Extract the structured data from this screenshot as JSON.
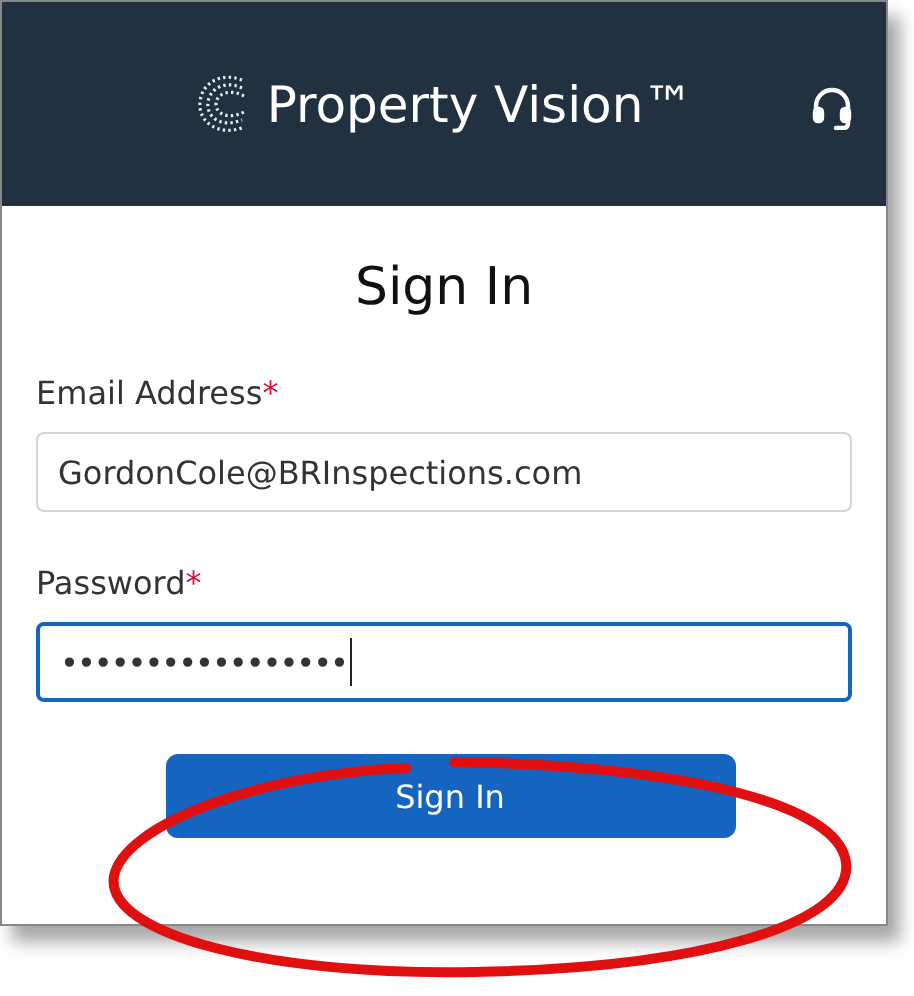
{
  "header": {
    "title": "Property Vision™"
  },
  "form": {
    "title": "Sign In",
    "fields": [
      {
        "label": "Email Address",
        "required_mark": "*",
        "value": "GordonCole@BRInspections.com",
        "focused": false
      },
      {
        "label": "Password",
        "required_mark": "*",
        "value": "•••••••••••••••••",
        "focused": true
      }
    ],
    "button": "Sign In"
  }
}
